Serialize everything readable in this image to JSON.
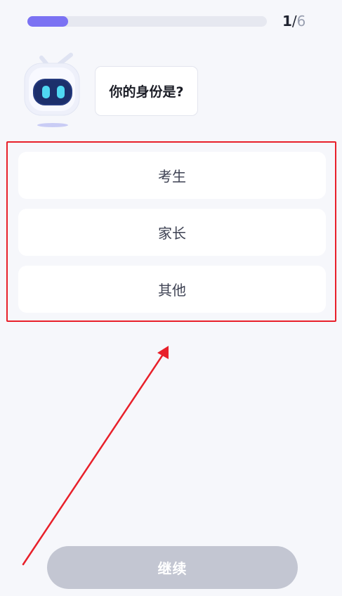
{
  "progress": {
    "current": "1",
    "separator": "/",
    "total": "6",
    "fraction": 0.17
  },
  "question": {
    "text": "你的身份是?"
  },
  "options": [
    {
      "label": "考生"
    },
    {
      "label": "家长"
    },
    {
      "label": "其他"
    }
  ],
  "footer": {
    "continue_label": "继续"
  },
  "colors": {
    "accent": "#7b72f3",
    "highlight_frame": "#e8202a",
    "button_disabled": "#c3c6d2"
  }
}
